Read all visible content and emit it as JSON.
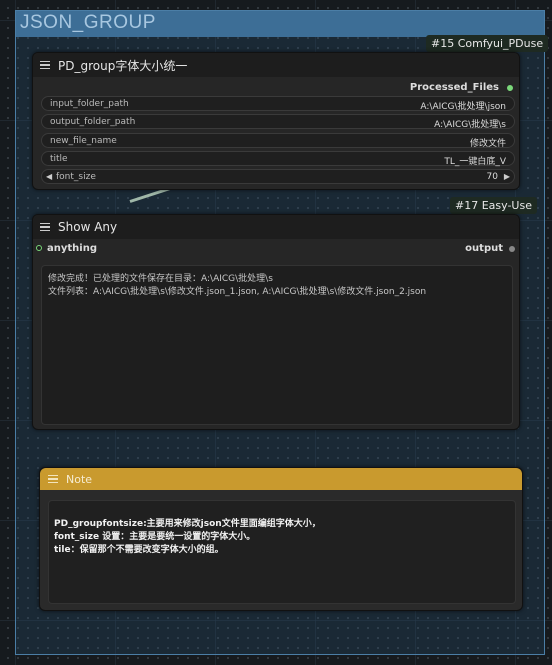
{
  "group": {
    "title": "JSON_GROUP"
  },
  "node15": {
    "badge": "#15 Comfyui_PDuse",
    "title": "PD_group字体大小统一",
    "output_label": "Processed_Files",
    "widgets": [
      {
        "name": "input_folder_path",
        "value": "A:\\AICG\\批处理\\json"
      },
      {
        "name": "output_folder_path",
        "value": "A:\\AICG\\批处理\\s"
      },
      {
        "name": "new_file_name",
        "value": "修改文件"
      },
      {
        "name": "title",
        "value": "TL_一键白底_V"
      },
      {
        "name": "font_size",
        "value": "70"
      }
    ]
  },
  "node17": {
    "badge": "#17 Easy-Use",
    "title": "Show Any",
    "input_label": "anything",
    "output_label": "output",
    "text": "修改完成！已处理的文件保存在目录：A:\\AICG\\批处理\\s\n文件列表：A:\\AICG\\批处理\\s\\修改文件.json_1.json, A:\\AICG\\批处理\\s\\修改文件.json_2.json"
  },
  "note": {
    "title": "Note",
    "text": "PD_groupfontsize:主要用来修改json文件里面编组字体大小，\nfont_size 设置：主要是要统一设置的字体大小。\ntile：保留那个不需要改变字体大小的组。"
  },
  "colors": {
    "group_header": "#3d6e96",
    "note_header": "#c99a2e",
    "output_dot": "#7bd87a"
  }
}
